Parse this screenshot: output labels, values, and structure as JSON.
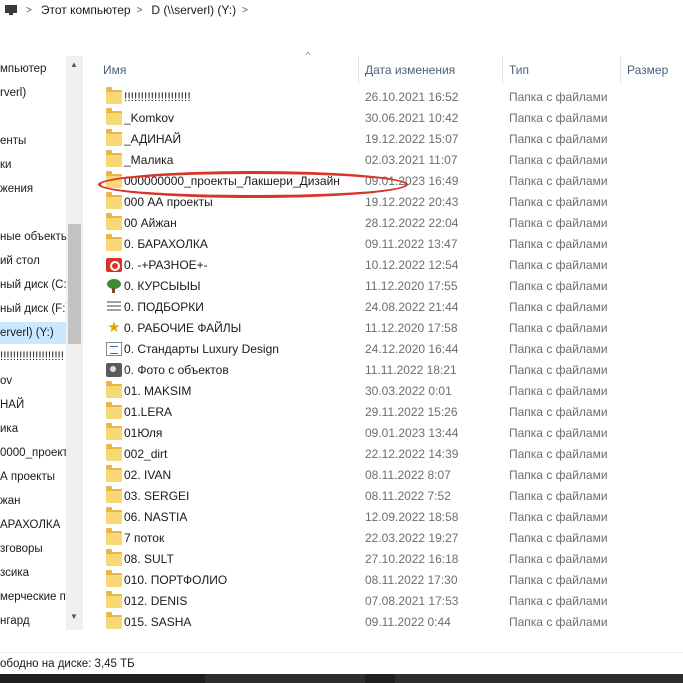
{
  "address": {
    "segments": [
      "Этот компьютер",
      "D (\\\\serverl) (Y:)"
    ],
    "separator": ">"
  },
  "nav": {
    "items": [
      {
        "label": "мпьютер"
      },
      {
        "label": "rverl)"
      },
      {
        "label": ""
      },
      {
        "label": "енты"
      },
      {
        "label": "ки"
      },
      {
        "label": "жения"
      },
      {
        "label": ""
      },
      {
        "label": "ные объекты"
      },
      {
        "label": "ий стол"
      },
      {
        "label": "ный диск (C:"
      },
      {
        "label": "ный диск (F:)"
      },
      {
        "label": "erverl) (Y:)"
      },
      {
        "label": "!!!!!!!!!!!!!!!!!!!!"
      },
      {
        "label": "ov"
      },
      {
        "label": "НАЙ"
      },
      {
        "label": "ика"
      },
      {
        "label": "0000_проекть"
      },
      {
        "label": "А проекты"
      },
      {
        "label": "жан"
      },
      {
        "label": "АРАХОЛКА"
      },
      {
        "label": "зговоры"
      },
      {
        "label": "зсика"
      },
      {
        "label": "мерческие пр"
      },
      {
        "label": "нгард"
      }
    ],
    "selected_index": 11
  },
  "columns": {
    "name": "Имя",
    "date": "Дата изменения",
    "type": "Тип",
    "size": "Размер"
  },
  "files": [
    {
      "name": "!!!!!!!!!!!!!!!!!!!!",
      "date": "26.10.2021 16:52",
      "type": "Папка с файлами",
      "icon": "folder"
    },
    {
      "name": "_Komkov",
      "date": "30.06.2021 10:42",
      "type": "Папка с файлами",
      "icon": "folder"
    },
    {
      "name": "_АДИНАЙ",
      "date": "19.12.2022 15:07",
      "type": "Папка с файлами",
      "icon": "folder"
    },
    {
      "name": "_Малика",
      "date": "02.03.2021 11:07",
      "type": "Папка с файлами",
      "icon": "folder"
    },
    {
      "name": "000000000_проекты_Лакшери_Дизайн",
      "date": "09.01.2023 16:49",
      "type": "Папка с файлами",
      "icon": "folder"
    },
    {
      "name": "000 АА проекты",
      "date": "19.12.2022 20:43",
      "type": "Папка с файлами",
      "icon": "folder"
    },
    {
      "name": "00 Айжан",
      "date": "28.12.2022 22:04",
      "type": "Папка с файлами",
      "icon": "folder"
    },
    {
      "name": "0.  БАРАХОЛКА",
      "date": "09.11.2022 13:47",
      "type": "Папка с файлами",
      "icon": "folder"
    },
    {
      "name": "0. -+РАЗНОЕ+-",
      "date": "10.12.2022 12:54",
      "type": "Папка с файлами",
      "icon": "red-circle-icon"
    },
    {
      "name": "0. КУРСЫЫЫ",
      "date": "11.12.2020 17:55",
      "type": "Папка с файлами",
      "icon": "tree-icon"
    },
    {
      "name": "0. ПОДБОРКИ",
      "date": "24.08.2022 21:44",
      "type": "Папка с файлами",
      "icon": "list-icon"
    },
    {
      "name": "0. РАБОЧИЕ ФАЙЛЫ",
      "date": "11.12.2020 17:58",
      "type": "Папка с файлами",
      "icon": "star-icon"
    },
    {
      "name": "0. Стандарты Luxury Design",
      "date": "24.12.2020 16:44",
      "type": "Папка с файлами",
      "icon": "document-icon"
    },
    {
      "name": "0. Фото с объектов",
      "date": "11.11.2022 18:21",
      "type": "Папка с файлами",
      "icon": "camera-icon"
    },
    {
      "name": "01. MAKSIM",
      "date": "30.03.2022 0:01",
      "type": "Папка с файлами",
      "icon": "folder"
    },
    {
      "name": "01.LERA",
      "date": "29.11.2022 15:26",
      "type": "Папка с файлами",
      "icon": "folder"
    },
    {
      "name": "01Юля",
      "date": "09.01.2023 13:44",
      "type": "Папка с файлами",
      "icon": "folder"
    },
    {
      "name": "002_dirt",
      "date": "22.12.2022 14:39",
      "type": "Папка с файлами",
      "icon": "folder"
    },
    {
      "name": "02. IVAN",
      "date": "08.11.2022 8:07",
      "type": "Папка с файлами",
      "icon": "folder"
    },
    {
      "name": "03. SERGEI",
      "date": "08.11.2022 7:52",
      "type": "Папка с файлами",
      "icon": "folder"
    },
    {
      "name": "06. NASTIA",
      "date": "12.09.2022 18:58",
      "type": "Папка с файлами",
      "icon": "folder"
    },
    {
      "name": "7 поток",
      "date": "22.03.2022 19:27",
      "type": "Папка с файлами",
      "icon": "folder"
    },
    {
      "name": "08. SULT",
      "date": "27.10.2022 16:18",
      "type": "Папка с файлами",
      "icon": "folder"
    },
    {
      "name": "010. ПОРТФОЛИО",
      "date": "08.11.2022 17:30",
      "type": "Папка с файлами",
      "icon": "folder"
    },
    {
      "name": "012. DENIS",
      "date": "07.08.2021 17:53",
      "type": "Папка с файлами",
      "icon": "folder"
    },
    {
      "name": "015. SASHA",
      "date": "09.11.2022 0:44",
      "type": "Папка с файлами",
      "icon": "folder"
    }
  ],
  "highlighted_index": 4,
  "status": {
    "text": "ободно на диске: 3,45 ТБ"
  },
  "colors": {
    "highlight_ellipse": "#d8352a",
    "selected_nav": "#cce8ff",
    "header_text": "#4c607a",
    "folder": "#f8d775"
  }
}
